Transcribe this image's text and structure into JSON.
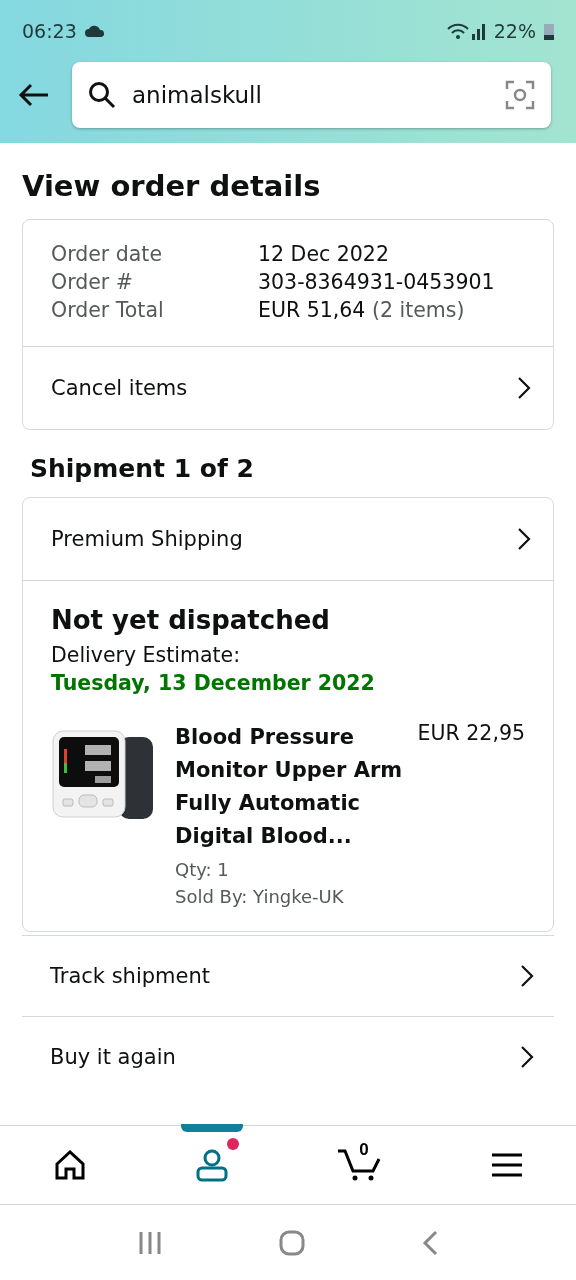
{
  "status_bar": {
    "time": "06:23",
    "battery": "22%"
  },
  "search": {
    "value": "animalskull"
  },
  "page_title": "View order details",
  "order_summary": {
    "rows": [
      {
        "label": "Order date",
        "value": "12 Dec 2022"
      },
      {
        "label": "Order #",
        "value": "303-8364931-0453901"
      },
      {
        "label": "Order Total",
        "value": "EUR 51,64",
        "note": "(2 items)"
      }
    ],
    "action": "Cancel items"
  },
  "shipment": {
    "title": "Shipment 1 of 2",
    "shipping_method": "Premium Shipping",
    "status": "Not yet dispatched",
    "estimate_label": "Delivery Estimate:",
    "estimate_date": "Tuesday, 13 December 2022",
    "item": {
      "kind": "picture",
      "title": "Blood Pressure Monitor Upper Arm Fully Automatic Digital Blood...",
      "price": "EUR 22,95",
      "qty": "Qty: 1",
      "seller": "Sold By: Yingke-UK"
    }
  },
  "actions": [
    "Track shipment",
    "Buy it again"
  ],
  "bottom_nav": [
    {
      "kind": "home",
      "selected": false
    },
    {
      "kind": "account",
      "selected": true,
      "notification": true
    },
    {
      "kind": "cart",
      "selected": false,
      "count": "0"
    },
    {
      "kind": "menu",
      "selected": false
    }
  ]
}
